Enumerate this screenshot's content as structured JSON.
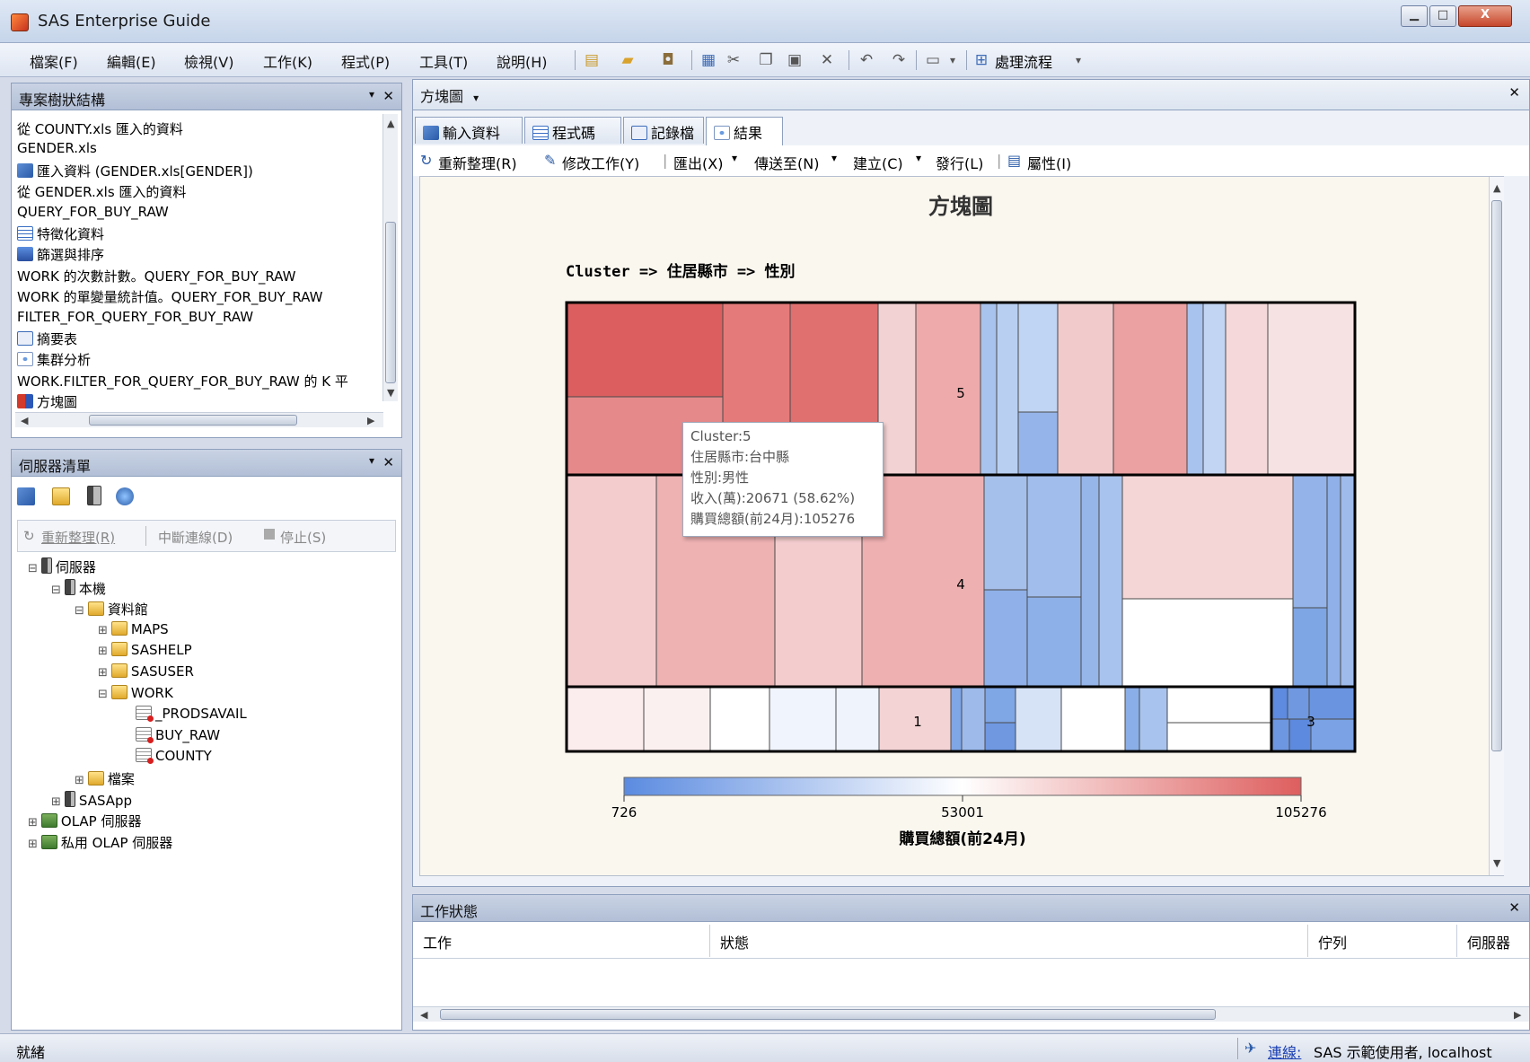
{
  "window": {
    "title": "SAS Enterprise Guide",
    "minimize": "▁",
    "maximize": "□",
    "close": "X"
  },
  "menu": [
    "檔案(F)",
    "編輯(E)",
    "檢視(V)",
    "工作(K)",
    "程式(P)",
    "工具(T)",
    "說明(H)"
  ],
  "toolbar": {
    "flow_label": "處理流程",
    "dropdown": "▾"
  },
  "project_tree": {
    "title": "專案樹狀結構",
    "items": [
      {
        "label": "從 COUNTY.xls 匯入的資料",
        "icon": ""
      },
      {
        "label": "GENDER.xls",
        "icon": ""
      },
      {
        "label": "匯入資料 (GENDER.xls[GENDER])",
        "icon": "import-icon"
      },
      {
        "label": "從 GENDER.xls 匯入的資料",
        "icon": ""
      },
      {
        "label": "QUERY_FOR_BUY_RAW",
        "icon": ""
      },
      {
        "label": "特徵化資料",
        "icon": "table-icon"
      },
      {
        "label": "篩選與排序",
        "icon": "filter-icon"
      },
      {
        "label": "WORK 的次數計數。QUERY_FOR_BUY_RAW",
        "icon": ""
      },
      {
        "label": "WORK 的單變量統計值。QUERY_FOR_BUY_RAW",
        "icon": ""
      },
      {
        "label": "FILTER_FOR_QUERY_FOR_BUY_RAW",
        "icon": ""
      },
      {
        "label": "摘要表",
        "icon": "summary-icon"
      },
      {
        "label": "集群分析",
        "icon": "cluster-icon"
      },
      {
        "label": "WORK.FILTER_FOR_QUERY_FOR_BUY_RAW 的 K 平",
        "icon": ""
      },
      {
        "label": "方塊圖",
        "icon": "mosaic-icon"
      }
    ]
  },
  "server_list": {
    "title": "伺服器清單",
    "refresh": "重新整理(R)",
    "disconnect": "中斷連線(D)",
    "stop": "停止(S)",
    "nodes": [
      {
        "label": "伺服器",
        "level": 0,
        "icon": "server-icon"
      },
      {
        "label": "本機",
        "level": 1,
        "icon": "server-icon"
      },
      {
        "label": "資料館",
        "level": 2,
        "icon": "library-icon"
      },
      {
        "label": "MAPS",
        "level": 3,
        "icon": "library-icon"
      },
      {
        "label": "SASHELP",
        "level": 3,
        "icon": "library-icon"
      },
      {
        "label": "SASUSER",
        "level": 3,
        "icon": "library-icon"
      },
      {
        "label": "WORK",
        "level": 3,
        "icon": "library-icon"
      },
      {
        "label": "_PRODSAVAIL",
        "level": 4,
        "icon": "dataset-icon"
      },
      {
        "label": "BUY_RAW",
        "level": 4,
        "icon": "dataset-icon"
      },
      {
        "label": "COUNTY",
        "level": 4,
        "icon": "dataset-icon"
      },
      {
        "label": "檔案",
        "level": 2,
        "icon": "folder-icon"
      },
      {
        "label": "SASApp",
        "level": 1,
        "icon": "server-icon"
      },
      {
        "label": "OLAP 伺服器",
        "level": 0,
        "icon": "olap-icon"
      },
      {
        "label": "私用 OLAP 伺服器",
        "level": 0,
        "icon": "olap-icon"
      }
    ]
  },
  "document": {
    "title": "方塊圖",
    "tabs": [
      "輸入資料",
      "程式碼",
      "記錄檔",
      "結果"
    ],
    "active_tab": "結果",
    "result_toolbar": [
      "重新整理(R)",
      "修改工作(Y)",
      "匯出(X)",
      "傳送至(N)",
      "建立(C)",
      "發行(L)",
      "屬性(I)"
    ]
  },
  "chart_data": {
    "type": "mosaic",
    "title": "方塊圖",
    "subtitle": "Cluster => 住居縣市 => 性別",
    "row_labels": [
      "5",
      "4",
      "1",
      "3"
    ],
    "colorbar": {
      "min": "726",
      "mid": "53001",
      "max": "105276",
      "label": "購買總額(前24月)",
      "low_color": "#5b8be0",
      "mid_color": "#ffffff",
      "high_color": "#de5e5e"
    }
  },
  "tooltip": {
    "lines": [
      "Cluster:5",
      "住居縣市:台中縣",
      "性別:男性",
      "收入(萬):20671 (58.62%)",
      "購買總額(前24月):105276"
    ]
  },
  "task_status": {
    "title": "工作狀態",
    "columns": [
      "工作",
      "狀態",
      "佇列",
      "伺服器"
    ]
  },
  "status_bar": {
    "left": "就緒",
    "link": "連線:",
    "right": "SAS 示範使用者, localhost"
  }
}
